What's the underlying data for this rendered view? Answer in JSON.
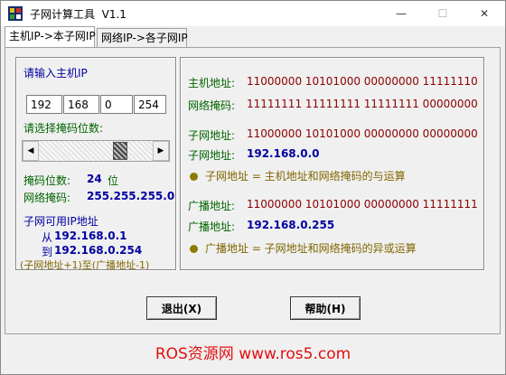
{
  "window": {
    "title": "子网计算工具  V1.1",
    "controls": {
      "minimize": "—",
      "maximize": "☐",
      "close": "✕"
    }
  },
  "tabs": [
    {
      "label": "主机IP->本子网IP",
      "active": true
    },
    {
      "label": "网络IP->各子网IP",
      "active": false
    }
  ],
  "input": {
    "host_ip_label": "请输入主机IP",
    "octets": [
      "192",
      "168",
      "0",
      "254"
    ],
    "mask_select_label": "请选择掩码位数:",
    "mask_bits_label": "掩码位数:",
    "mask_bits_value": "24",
    "mask_bits_unit": "位",
    "netmask_label": "网络掩码:",
    "netmask_value": "255.255.255.0",
    "slider_level_bits": 24
  },
  "range": {
    "title": "子网可用IP地址",
    "from_label": "从",
    "from_value": "192.168.0.1",
    "to_label": "到",
    "to_value": "192.168.0.254",
    "note": "(子网地址+1)至(广播地址-1)"
  },
  "results": {
    "host_label": "主机地址:",
    "host_bin": "11000000  10101000  00000000  11111110",
    "mask_label": "网络掩码:",
    "mask_bin": "11111111  11111111  11111111  00000000",
    "subnet_bin_label": "子网地址:",
    "subnet_bin": "11000000  10101000  00000000  00000000",
    "subnet_label": "子网地址:",
    "subnet_value": "192.168.0.0",
    "subnet_note": "子网地址 = 主机地址和网络掩码的与运算",
    "bcast_bin_label": "广播地址:",
    "bcast_bin": "11000000  10101000  00000000  11111111",
    "bcast_label": "广播地址:",
    "bcast_value": "192.168.0.255",
    "bcast_note": "广播地址 = 子网地址和网络掩码的异或运算"
  },
  "buttons": {
    "exit": "退出(X)",
    "help": "帮助(H)"
  },
  "watermark": "ROS资源网  www.ros5.com",
  "colors": {
    "green": "#006400",
    "blue": "#0000a0",
    "red": "#8b0000",
    "olive": "#806600",
    "watermark": "#e01010"
  }
}
